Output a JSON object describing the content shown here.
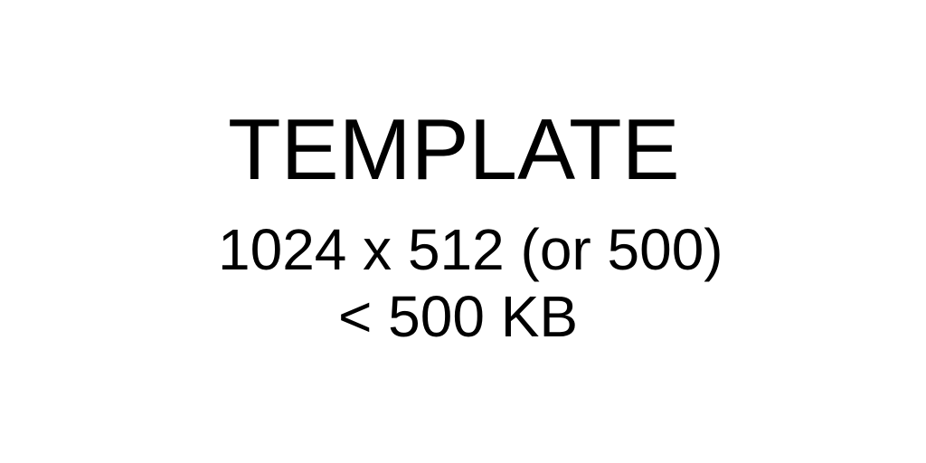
{
  "colors": {
    "background": "#ffffff",
    "text": "#000000"
  },
  "template": {
    "title": "TEMPLATE",
    "dimensions": "1024 x 512 (or 500)",
    "max_size": "< 500 KB"
  }
}
